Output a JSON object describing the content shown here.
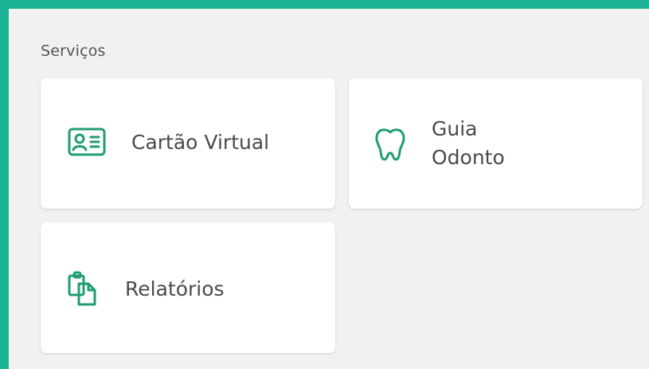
{
  "section": {
    "title": "Serviços"
  },
  "cards": [
    {
      "label": "Cartão Virtual",
      "icon": "id-card-icon"
    },
    {
      "label": "Guia\nOdonto",
      "icon": "tooth-icon"
    },
    {
      "label": "Relatórios",
      "icon": "clipboard-copy-icon"
    }
  ],
  "colors": {
    "accent": "#1bb394",
    "icon": "#1f9d74",
    "text": "#4a4a4a",
    "background": "#f1f1f1",
    "card": "#ffffff"
  }
}
